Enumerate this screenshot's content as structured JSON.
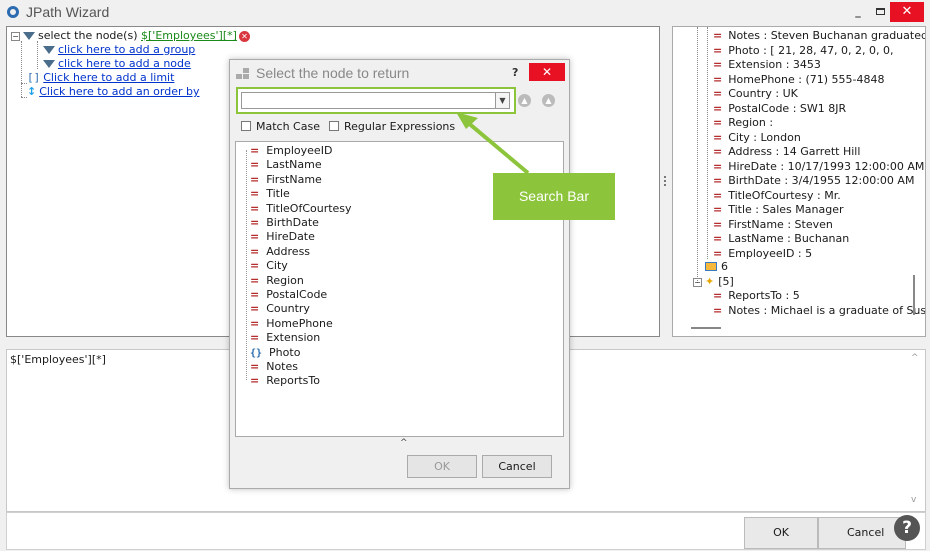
{
  "window": {
    "title": "JPath Wizard",
    "minimize": "_",
    "close": "✕"
  },
  "query": {
    "select_prefix": "select the node(s)",
    "node_path": "$['Employees'][*]",
    "add_group": "click here to add a group",
    "add_node": "click here to add a node",
    "add_limit": "Click here to add a limit",
    "add_order": "Click here to add an order by",
    "limit_icon": "[]"
  },
  "result": {
    "text": "$['Employees'][*]"
  },
  "data_tree": {
    "lines": [
      {
        "label": "Notes : Steven Buchanan graduated"
      },
      {
        "label": "Photo : [  21,  28,  47,  0,  2,  0,  0,"
      },
      {
        "label": "Extension : 3453"
      },
      {
        "label": "HomePhone : (71) 555-4848"
      },
      {
        "label": "Country : UK"
      },
      {
        "label": "PostalCode : SW1 8JR"
      },
      {
        "label": "Region :"
      },
      {
        "label": "City : London"
      },
      {
        "label": "Address : 14 Garrett Hill"
      },
      {
        "label": "HireDate : 10/17/1993 12:00:00 AM"
      },
      {
        "label": "BirthDate : 3/4/1955 12:00:00 AM"
      },
      {
        "label": "TitleOfCourtesy : Mr."
      },
      {
        "label": "Title : Sales Manager"
      },
      {
        "label": "FirstName : Steven"
      },
      {
        "label": "LastName : Buchanan"
      },
      {
        "label": "EmployeeID : 5"
      }
    ],
    "index_node": "6",
    "array_node": "[5]",
    "child_lines": [
      {
        "label": "ReportsTo : 5"
      },
      {
        "label": "Notes : Michael is a graduate of Suss"
      }
    ]
  },
  "footer": {
    "ok": "OK",
    "cancel": "Cancel",
    "help": "?"
  },
  "dialog": {
    "title": "Select the node to return",
    "help": "?",
    "close": "✕",
    "search_value": "",
    "match_case": "Match Case",
    "regex": "Regular Expressions",
    "nodes": [
      {
        "name": "EmployeeID",
        "icon": "="
      },
      {
        "name": "LastName",
        "icon": "="
      },
      {
        "name": "FirstName",
        "icon": "="
      },
      {
        "name": "Title",
        "icon": "="
      },
      {
        "name": "TitleOfCourtesy",
        "icon": "="
      },
      {
        "name": "BirthDate",
        "icon": "="
      },
      {
        "name": "HireDate",
        "icon": "="
      },
      {
        "name": "Address",
        "icon": "="
      },
      {
        "name": "City",
        "icon": "="
      },
      {
        "name": "Region",
        "icon": "="
      },
      {
        "name": "PostalCode",
        "icon": "="
      },
      {
        "name": "Country",
        "icon": "="
      },
      {
        "name": "HomePhone",
        "icon": "="
      },
      {
        "name": "Extension",
        "icon": "="
      },
      {
        "name": "Photo",
        "icon": "{}"
      },
      {
        "name": "Notes",
        "icon": "="
      },
      {
        "name": "ReportsTo",
        "icon": "="
      }
    ],
    "caret": "^",
    "ok": "OK",
    "cancel": "Cancel"
  },
  "callout": {
    "label": "Search Bar",
    "color": "#8cc43c"
  },
  "colors": {
    "close_red": "#e81123",
    "link_blue": "#0033cc",
    "field_red": "#b52d2d"
  }
}
